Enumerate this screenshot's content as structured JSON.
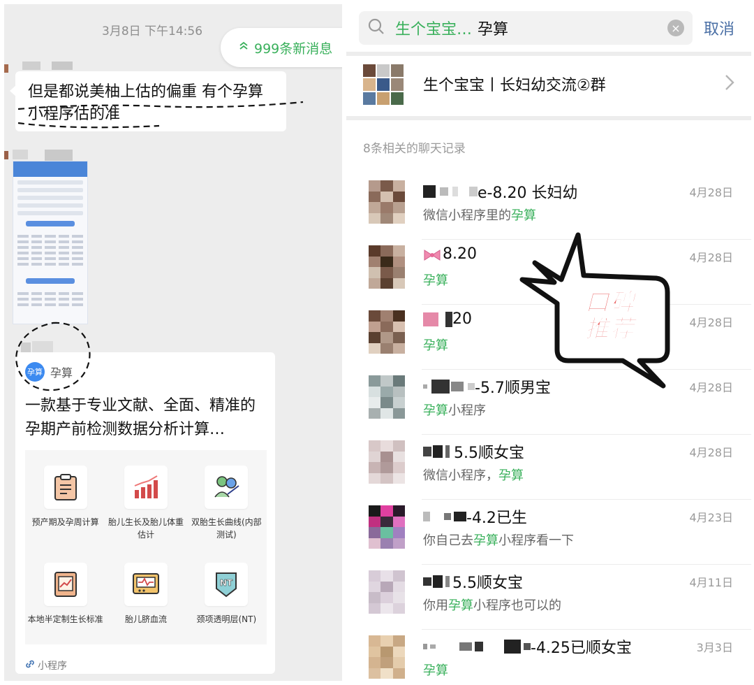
{
  "left": {
    "timestamp": "3月8日 下午14:56",
    "new_messages": "999条新消息",
    "bubble_text": "但是都说美柚上估的偏重 有个孕算小程序估的准",
    "mini_program": {
      "name": "孕算",
      "logo_text": "孕算",
      "description": "一款基于专业文献、全面、精准的孕期产前检测数据分析计算…",
      "tools": [
        {
          "label": "预产期及孕周计算",
          "icon": "clipboard-icon"
        },
        {
          "label": "胎儿生长及胎儿体重估计",
          "icon": "bar-chart-icon"
        },
        {
          "label": "双胎生长曲线(内部测试)",
          "icon": "twins-icon"
        },
        {
          "label": "本地半定制生长标准",
          "icon": "growth-card-icon"
        },
        {
          "label": "胎儿脐血流",
          "icon": "monitor-icon"
        },
        {
          "label": "颈项透明层(NT)",
          "icon": "nt-shield-icon"
        }
      ],
      "footer": "小程序"
    }
  },
  "right": {
    "search": {
      "keyword1": "生个宝宝…",
      "keyword2": "孕算"
    },
    "cancel_label": "取消",
    "group_name": "生个宝宝丨长妇幼交流②群",
    "records_title": "8条相关的聊天记录",
    "records": [
      {
        "name": "e-8.20 长妇幼",
        "date": "4月28日",
        "pre": "微信小程序里的",
        "hl": "孕算",
        "post": ""
      },
      {
        "name": "8.20",
        "date": "4月28日",
        "pre": "",
        "hl": "孕算",
        "post": ""
      },
      {
        "name": "20",
        "date": "4月28日",
        "pre": "",
        "hl": "孕算",
        "post": ""
      },
      {
        "name": "-5.7顺男宝",
        "date": "4月28日",
        "pre": "",
        "hl": "孕算",
        "post": "小程序"
      },
      {
        "name": "5.5顺女宝",
        "date": "4月28日",
        "pre": "微信小程序，",
        "hl": "孕算",
        "post": ""
      },
      {
        "name": "-4.2已生",
        "date": "4月23日",
        "pre": "你自己去",
        "hl": "孕算",
        "post": "小程序看一下"
      },
      {
        "name": "5.5顺女宝",
        "date": "4月11日",
        "pre": "你用",
        "hl": "孕算",
        "post": "小程序也可以的"
      },
      {
        "name": "-4.25已顺女宝",
        "date": "3月3日",
        "pre": "",
        "hl": "孕算",
        "post": ""
      }
    ]
  },
  "sticker": {
    "line1": "口碑",
    "line2": "推荐"
  },
  "colors": {
    "accent_green": "#39b05b",
    "link_blue": "#4a6fa5",
    "sticker_red": "#e85b5b"
  }
}
